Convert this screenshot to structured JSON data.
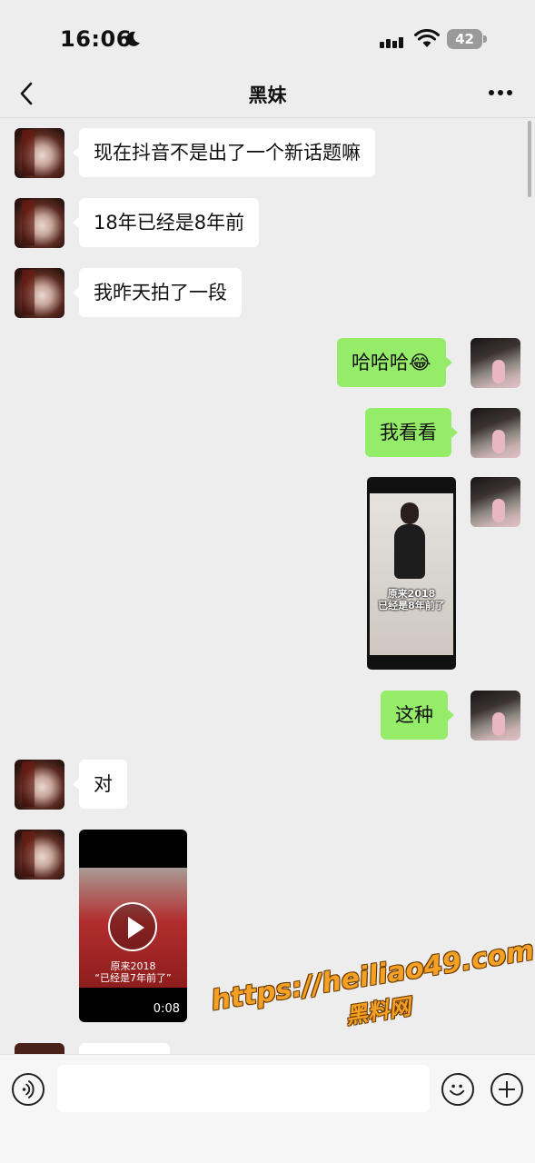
{
  "status": {
    "time": "16:06",
    "battery": "42"
  },
  "nav": {
    "title": "黑妹"
  },
  "messages": [
    {
      "side": "left",
      "text": "现在抖音不是出了一个新话题嘛"
    },
    {
      "side": "left",
      "text": "18年已经是8年前"
    },
    {
      "side": "left",
      "text": "我昨天拍了一段"
    },
    {
      "side": "right",
      "text": "哈哈哈😂"
    },
    {
      "side": "right",
      "text": "我看看"
    },
    {
      "side": "right",
      "type": "image",
      "caption_line1": "原来2018",
      "caption_line2": "已经是8年前了"
    },
    {
      "side": "right",
      "text": "这种"
    },
    {
      "side": "left",
      "text": "对"
    },
    {
      "side": "left",
      "type": "video",
      "caption_line1": "原来2018",
      "caption_line2": "“已经是7年前了”",
      "duration": "0:08"
    }
  ],
  "watermark": {
    "url": "https://heiliao49.com",
    "brand": "黑料网"
  },
  "icons": {
    "moon": "moon-icon",
    "signal": "cellular-signal-icon",
    "wifi": "wifi-icon",
    "back": "chevron-left-icon",
    "more": "more-dots-icon",
    "voice": "voice-input-icon",
    "emoji": "emoji-icon",
    "plus": "plus-icon",
    "play": "play-icon"
  },
  "colors": {
    "background": "#ededed",
    "bubble_self": "#95ec69",
    "bubble_other": "#ffffff",
    "watermark": "#f3a024"
  }
}
